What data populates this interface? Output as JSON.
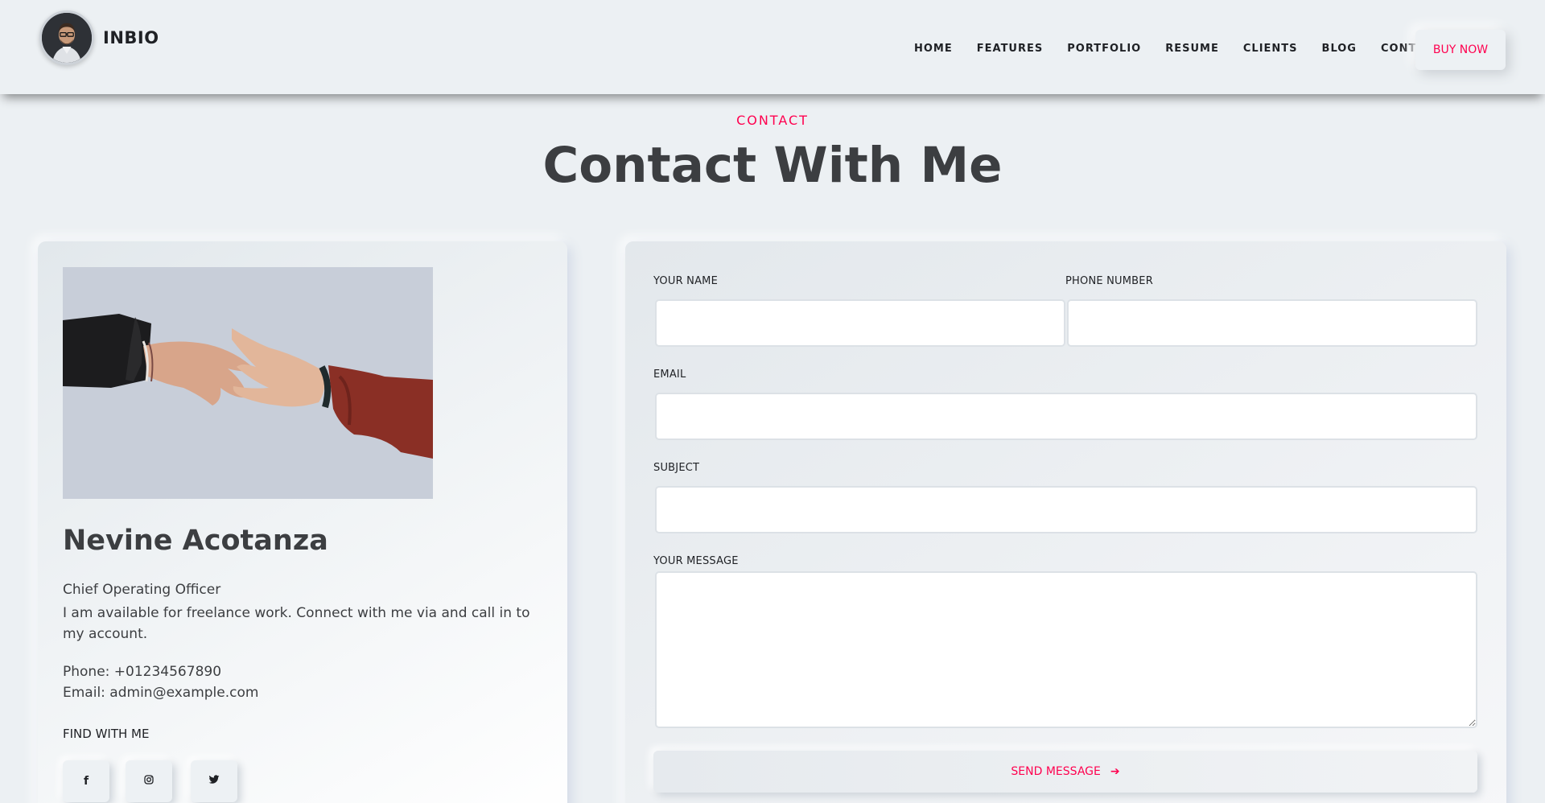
{
  "header": {
    "brand": "INBIO",
    "nav": [
      "HOME",
      "FEATURES",
      "PORTFOLIO",
      "RESUME",
      "CLIENTS",
      "BLOG",
      "CONTACT"
    ],
    "cta": "BUY NOW"
  },
  "section": {
    "subtitle": "CONTACT",
    "title": "Contact With Me"
  },
  "profile": {
    "name": "Nevine Acotanza",
    "role": "Chief Operating Officer",
    "bio": "I am available for freelance work. Connect with me via and call in to my account.",
    "phone": "Phone: +01234567890",
    "email": "Email: admin@example.com",
    "find_label": "FIND WITH ME",
    "social": [
      {
        "icon": "facebook-icon",
        "glyph": "f"
      },
      {
        "icon": "instagram-icon",
        "glyph": "◎"
      },
      {
        "icon": "twitter-icon",
        "glyph": "🐦"
      }
    ]
  },
  "form": {
    "name_label": "YOUR NAME",
    "phone_label": "PHONE NUMBER",
    "email_label": "EMAIL",
    "subject_label": "SUBJECT",
    "message_label": "YOUR MESSAGE",
    "name_value": "",
    "phone_value": "",
    "email_value": "",
    "subject_value": "",
    "message_value": "",
    "submit_label": "SEND MESSAGE",
    "submit_icon": "arrow-right-icon",
    "submit_glyph": "➔"
  },
  "colors": {
    "accent": "#ff014f",
    "background": "#ecf0f3",
    "text": "#3c3e41"
  }
}
